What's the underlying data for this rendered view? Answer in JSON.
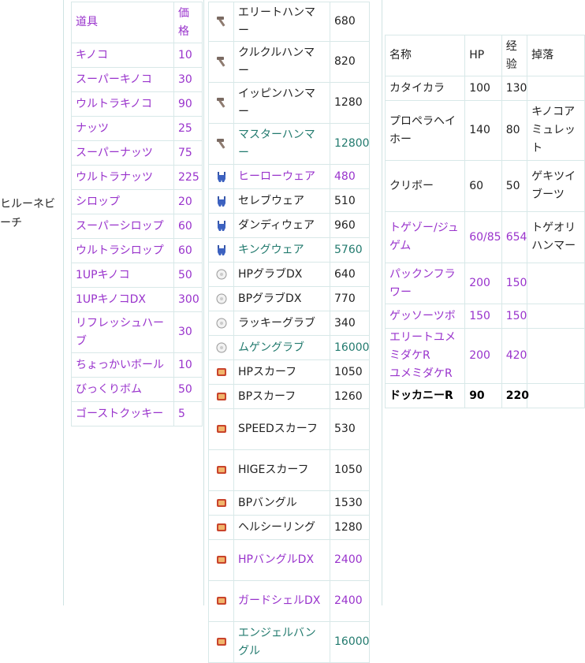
{
  "row_label": "ヒルーネビーチ",
  "items": {
    "headers": [
      "道具",
      "価格"
    ],
    "rows": [
      [
        "キノコ",
        "10"
      ],
      [
        "スーパーキノコ",
        "30"
      ],
      [
        "ウルトラキノコ",
        "90"
      ],
      [
        "ナッツ",
        "25"
      ],
      [
        "スーパーナッツ",
        "75"
      ],
      [
        "ウルトラナッツ",
        "225"
      ],
      [
        "シロップ",
        "20"
      ],
      [
        "スーパーシロップ",
        "60"
      ],
      [
        "ウルトラシロップ",
        "60"
      ],
      [
        "1UPキノコ",
        "50"
      ],
      [
        "1UPキノコDX",
        "300"
      ],
      [
        "リフレッシュハーブ",
        "30"
      ],
      [
        "ちょっかいボール",
        "10"
      ],
      [
        "びっくりボム",
        "50"
      ],
      [
        "ゴーストクッキー",
        "5"
      ]
    ]
  },
  "equipment": {
    "rows": [
      {
        "icon": "hammer-icon",
        "name": "エリートハンマー",
        "price": "680",
        "color": "blk"
      },
      {
        "icon": "hammer-icon",
        "name": "クルクルハンマー",
        "price": "820",
        "color": "blk"
      },
      {
        "icon": "hammer-icon",
        "name": "イッピンハンマー",
        "price": "1280",
        "color": "blk"
      },
      {
        "icon": "hammer-icon",
        "name": "マスターハンマー",
        "price": "12800",
        "color": "grn"
      },
      {
        "icon": "overalls-icon",
        "name": "ヒーローウェア",
        "price": "480",
        "color": "pur"
      },
      {
        "icon": "overalls-icon",
        "name": "セレブウェア",
        "price": "510",
        "color": "blk"
      },
      {
        "icon": "overalls-icon",
        "name": "ダンディウェア",
        "price": "960",
        "color": "blk"
      },
      {
        "icon": "overalls-icon",
        "name": "キングウェア",
        "price": "5760",
        "color": "grn"
      },
      {
        "icon": "glove-icon",
        "name": "HPグラブDX",
        "price": "640",
        "color": "blk"
      },
      {
        "icon": "glove-icon",
        "name": "BPグラブDX",
        "price": "770",
        "color": "blk"
      },
      {
        "icon": "glove-icon",
        "name": "ラッキーグラブ",
        "price": "340",
        "color": "blk"
      },
      {
        "icon": "glove-icon",
        "name": "ムゲングラブ",
        "price": "16000",
        "color": "grn"
      },
      {
        "icon": "accessory-icon",
        "name": "HPスカーフ",
        "price": "1050",
        "color": "blk"
      },
      {
        "icon": "accessory-icon",
        "name": "BPスカーフ",
        "price": "1260",
        "color": "blk"
      },
      {
        "icon": "accessory-icon",
        "name": "SPEEDスカーフ",
        "price": "530",
        "color": "blk"
      },
      {
        "icon": "accessory-icon",
        "name": "HIGEスカーフ",
        "price": "1050",
        "color": "blk"
      },
      {
        "icon": "accessory-icon",
        "name": "BPバングル",
        "price": "1530",
        "color": "blk"
      },
      {
        "icon": "accessory-icon",
        "name": "ヘルシーリング",
        "price": "1280",
        "color": "blk"
      },
      {
        "icon": "accessory-icon",
        "name": "HPバングルDX",
        "price": "2400",
        "color": "pur"
      },
      {
        "icon": "accessory-icon",
        "name": "ガードシェルDX",
        "price": "2400",
        "color": "pur"
      },
      {
        "icon": "accessory-icon",
        "name": "エンジェルバングル",
        "price": "16000",
        "color": "grn"
      }
    ]
  },
  "enemies": {
    "headers": [
      "名称",
      "HP",
      "经验",
      "掉落"
    ],
    "rows": [
      {
        "name": "カタイカラ",
        "hp": "100",
        "exp": "130",
        "drop": "",
        "color": "blk"
      },
      {
        "name": "プロペラヘイホー",
        "hp": "140",
        "exp": "80",
        "drop": "キノコアミュレット",
        "color": "blk"
      },
      {
        "name": "クリボー",
        "hp": "60",
        "exp": "50",
        "drop": "ゲキツイブーツ",
        "color": "blk"
      },
      {
        "name": "トゲゾー/ジュゲム",
        "hp": "60/85",
        "exp": "654",
        "drop": "トゲオリハンマー",
        "color": "pur"
      },
      {
        "name": "パックンフラワー",
        "hp": "200",
        "exp": "150",
        "drop": "",
        "color": "pur"
      },
      {
        "name": "ゲッソーツボ",
        "hp": "150",
        "exp": "150",
        "drop": "",
        "color": "pur"
      },
      {
        "name": "エリートユメミダケR ユメミダケR",
        "hp": "200",
        "exp": "420",
        "drop": "",
        "color": "pur"
      },
      {
        "name": "ドッカニーR",
        "hp": "90",
        "exp": "220",
        "drop": "",
        "color": "bold"
      }
    ]
  }
}
